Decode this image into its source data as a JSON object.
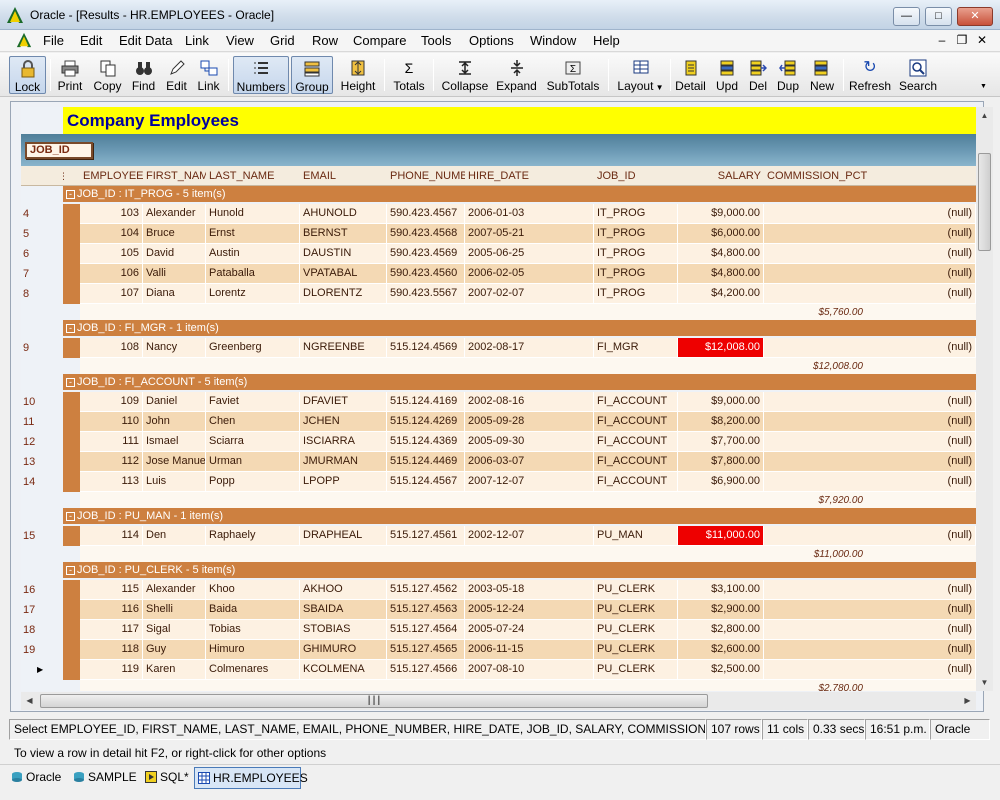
{
  "window": {
    "title": "Oracle - [Results - HR.EMPLOYEES - Oracle]"
  },
  "menu": [
    "File",
    "Edit",
    "Edit Data",
    "Link",
    "View",
    "Grid",
    "Row",
    "Compare",
    "Tools",
    "Options",
    "Window",
    "Help"
  ],
  "toolbar": {
    "lock": "Lock",
    "print": "Print",
    "copy": "Copy",
    "find": "Find",
    "edit": "Edit",
    "link": "Link",
    "numbers": "Numbers",
    "group": "Group",
    "height": "Height",
    "totals": "Totals",
    "collapse": "Collapse",
    "expand": "Expand",
    "subtotals": "SubTotals",
    "layout": "Layout",
    "detail": "Detail",
    "upd": "Upd",
    "del": "Del",
    "dup": "Dup",
    "new": "New",
    "refresh": "Refresh",
    "search": "Search"
  },
  "grid": {
    "title": "Company Employees",
    "group_chip": "JOB_ID",
    "columns": [
      "EMPLOYEE_ID",
      "FIRST_NAME",
      "LAST_NAME",
      "EMAIL",
      "PHONE_NUMBER",
      "HIRE_DATE",
      "JOB_ID",
      "SALARY",
      "COMMISSION_PCT"
    ],
    "groups": [
      {
        "header": "JOB_ID : IT_PROG - 5 item(s)",
        "subtotal": "$5,760.00",
        "rows": [
          {
            "n": "4",
            "id": "103",
            "first": "Alexander",
            "last": "Hunold",
            "email": "AHUNOLD",
            "phone": "590.423.4567",
            "hire": "2006-01-03",
            "job": "IT_PROG",
            "salary": "$9,000.00",
            "comm": "(null)",
            "hi": false
          },
          {
            "n": "5",
            "id": "104",
            "first": "Bruce",
            "last": "Ernst",
            "email": "BERNST",
            "phone": "590.423.4568",
            "hire": "2007-05-21",
            "job": "IT_PROG",
            "salary": "$6,000.00",
            "comm": "(null)",
            "hi": false
          },
          {
            "n": "6",
            "id": "105",
            "first": "David",
            "last": "Austin",
            "email": "DAUSTIN",
            "phone": "590.423.4569",
            "hire": "2005-06-25",
            "job": "IT_PROG",
            "salary": "$4,800.00",
            "comm": "(null)",
            "hi": false
          },
          {
            "n": "7",
            "id": "106",
            "first": "Valli",
            "last": "Pataballa",
            "email": "VPATABAL",
            "phone": "590.423.4560",
            "hire": "2006-02-05",
            "job": "IT_PROG",
            "salary": "$4,800.00",
            "comm": "(null)",
            "hi": false
          },
          {
            "n": "8",
            "id": "107",
            "first": "Diana",
            "last": "Lorentz",
            "email": "DLORENTZ",
            "phone": "590.423.5567",
            "hire": "2007-02-07",
            "job": "IT_PROG",
            "salary": "$4,200.00",
            "comm": "(null)",
            "hi": false
          }
        ]
      },
      {
        "header": "JOB_ID : FI_MGR - 1 item(s)",
        "subtotal": "$12,008.00",
        "rows": [
          {
            "n": "9",
            "id": "108",
            "first": "Nancy",
            "last": "Greenberg",
            "email": "NGREENBE",
            "phone": "515.124.4569",
            "hire": "2002-08-17",
            "job": "FI_MGR",
            "salary": "$12,008.00",
            "comm": "(null)",
            "hi": true
          }
        ]
      },
      {
        "header": "JOB_ID : FI_ACCOUNT - 5 item(s)",
        "subtotal": "$7,920.00",
        "rows": [
          {
            "n": "10",
            "id": "109",
            "first": "Daniel",
            "last": "Faviet",
            "email": "DFAVIET",
            "phone": "515.124.4169",
            "hire": "2002-08-16",
            "job": "FI_ACCOUNT",
            "salary": "$9,000.00",
            "comm": "(null)",
            "hi": false
          },
          {
            "n": "11",
            "id": "110",
            "first": "John",
            "last": "Chen",
            "email": "JCHEN",
            "phone": "515.124.4269",
            "hire": "2005-09-28",
            "job": "FI_ACCOUNT",
            "salary": "$8,200.00",
            "comm": "(null)",
            "hi": false
          },
          {
            "n": "12",
            "id": "111",
            "first": "Ismael",
            "last": "Sciarra",
            "email": "ISCIARRA",
            "phone": "515.124.4369",
            "hire": "2005-09-30",
            "job": "FI_ACCOUNT",
            "salary": "$7,700.00",
            "comm": "(null)",
            "hi": false
          },
          {
            "n": "13",
            "id": "112",
            "first": "Jose Manuel",
            "last": "Urman",
            "email": "JMURMAN",
            "phone": "515.124.4469",
            "hire": "2006-03-07",
            "job": "FI_ACCOUNT",
            "salary": "$7,800.00",
            "comm": "(null)",
            "hi": false
          },
          {
            "n": "14",
            "id": "113",
            "first": "Luis",
            "last": "Popp",
            "email": "LPOPP",
            "phone": "515.124.4567",
            "hire": "2007-12-07",
            "job": "FI_ACCOUNT",
            "salary": "$6,900.00",
            "comm": "(null)",
            "hi": false
          }
        ]
      },
      {
        "header": "JOB_ID : PU_MAN - 1 item(s)",
        "subtotal": "$11,000.00",
        "rows": [
          {
            "n": "15",
            "id": "114",
            "first": "Den",
            "last": "Raphaely",
            "email": "DRAPHEAL",
            "phone": "515.127.4561",
            "hire": "2002-12-07",
            "job": "PU_MAN",
            "salary": "$11,000.00",
            "comm": "(null)",
            "hi": true
          }
        ]
      },
      {
        "header": "JOB_ID : PU_CLERK - 5 item(s)",
        "subtotal": "$2,780.00",
        "rows": [
          {
            "n": "16",
            "id": "115",
            "first": "Alexander",
            "last": "Khoo",
            "email": "AKHOO",
            "phone": "515.127.4562",
            "hire": "2003-05-18",
            "job": "PU_CLERK",
            "salary": "$3,100.00",
            "comm": "(null)",
            "hi": false
          },
          {
            "n": "17",
            "id": "116",
            "first": "Shelli",
            "last": "Baida",
            "email": "SBAIDA",
            "phone": "515.127.4563",
            "hire": "2005-12-24",
            "job": "PU_CLERK",
            "salary": "$2,900.00",
            "comm": "(null)",
            "hi": false
          },
          {
            "n": "18",
            "id": "117",
            "first": "Sigal",
            "last": "Tobias",
            "email": "STOBIAS",
            "phone": "515.127.4564",
            "hire": "2005-07-24",
            "job": "PU_CLERK",
            "salary": "$2,800.00",
            "comm": "(null)",
            "hi": false
          },
          {
            "n": "19",
            "id": "118",
            "first": "Guy",
            "last": "Himuro",
            "email": "GHIMURO",
            "phone": "515.127.4565",
            "hire": "2006-11-15",
            "job": "PU_CLERK",
            "salary": "$2,600.00",
            "comm": "(null)",
            "hi": false
          },
          {
            "n": "",
            "id": "119",
            "first": "Karen",
            "last": "Colmenares",
            "email": "KCOLMENA",
            "phone": "515.127.4566",
            "hire": "2007-08-10",
            "job": "PU_CLERK",
            "salary": "$2,500.00",
            "comm": "(null)",
            "hi": false,
            "current": true
          }
        ]
      }
    ]
  },
  "status": {
    "sql": "Select EMPLOYEE_ID, FIRST_NAME, LAST_NAME, EMAIL, PHONE_NUMBER, HIRE_DATE, JOB_ID, SALARY, COMMISSION_PCT, MAN",
    "rows": "107 rows",
    "cols": "11 cols",
    "secs": "0.33 secs",
    "time": "16:51 p.m.",
    "conn": "Oracle"
  },
  "hint": "To view a row in detail hit F2, or right-click for other options",
  "tabs": [
    "Oracle",
    "SAMPLE",
    "SQL*",
    "HR.EMPLOYEES"
  ],
  "colors": {
    "highlight": "#ee0000",
    "group": "#cd8040",
    "banner": "#ffff00"
  }
}
